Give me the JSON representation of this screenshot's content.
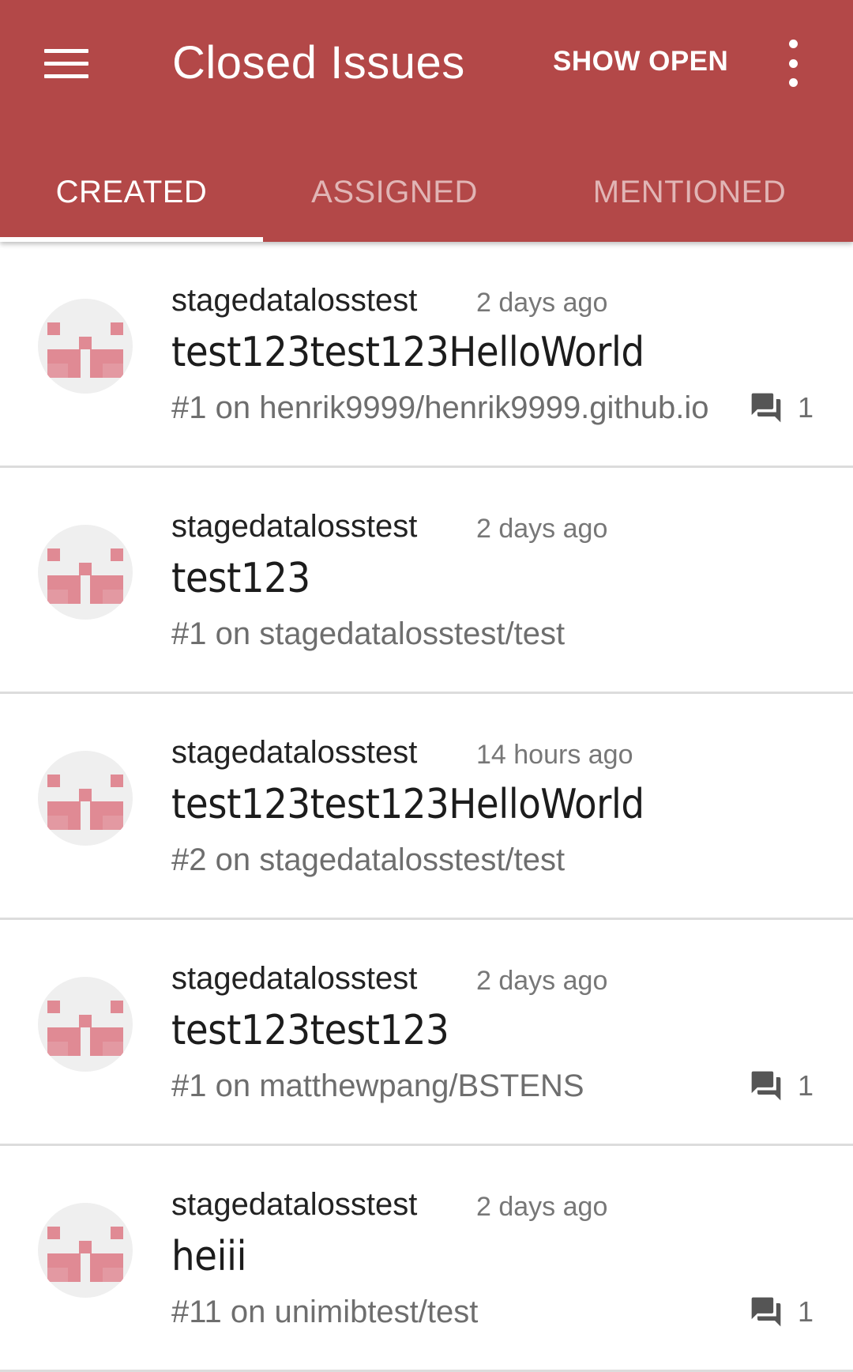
{
  "appbar": {
    "title": "Closed Issues",
    "show_open_label": "SHOW OPEN",
    "menu_icon": "menu-icon",
    "more_icon": "more-vert-icon",
    "color": "#b34848"
  },
  "tabs": [
    {
      "label": "CREATED",
      "active": true
    },
    {
      "label": "ASSIGNED",
      "active": false
    },
    {
      "label": "MENTIONED",
      "active": false
    }
  ],
  "issues": [
    {
      "author": "stagedatalosstest",
      "time": "2 days ago",
      "title": "test123test123HelloWorld",
      "meta": "#1 on henrik9999/henrik9999.github.io",
      "comments": "1"
    },
    {
      "author": "stagedatalosstest",
      "time": "2 days ago",
      "title": "test123",
      "meta": "#1 on stagedatalosstest/test",
      "comments": null
    },
    {
      "author": "stagedatalosstest",
      "time": "14 hours ago",
      "title": "test123test123HelloWorld",
      "meta": "#2 on stagedatalosstest/test",
      "comments": null
    },
    {
      "author": "stagedatalosstest",
      "time": "2 days ago",
      "title": "test123test123",
      "meta": "#1 on matthewpang/BSTENS",
      "comments": "1"
    },
    {
      "author": "stagedatalosstest",
      "time": "2 days ago",
      "title": "heiii",
      "meta": "#11 on unimibtest/test",
      "comments": "1"
    }
  ],
  "avatar_color": "#e08a94"
}
